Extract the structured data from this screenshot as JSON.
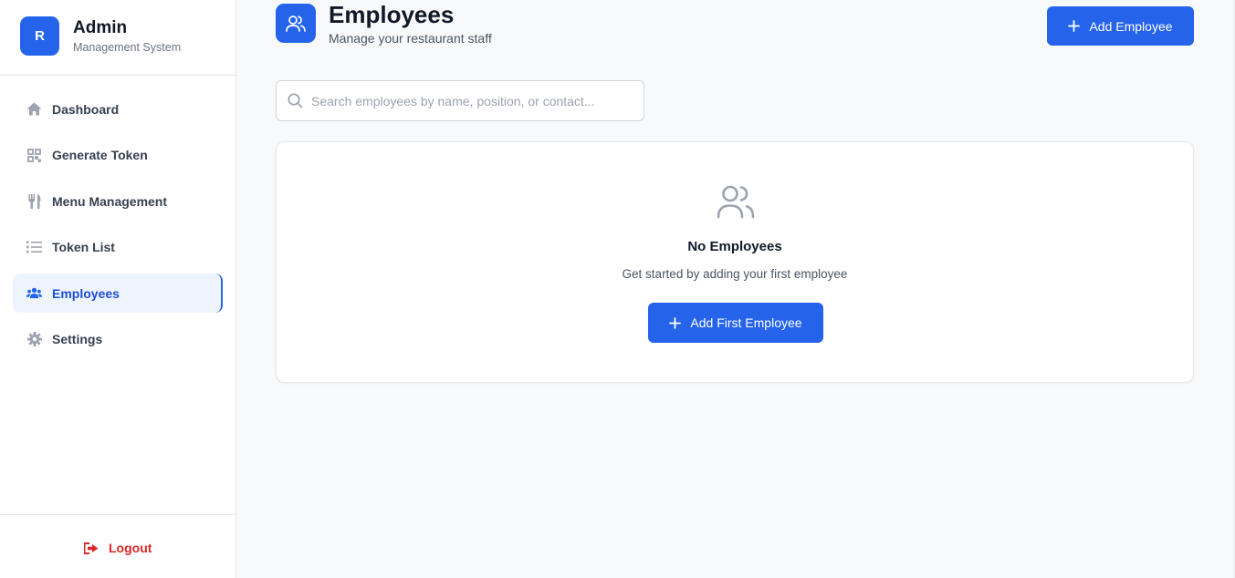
{
  "brand": {
    "logo_letter": "R",
    "title": "Admin",
    "subtitle": "Management System"
  },
  "sidebar": {
    "items": [
      {
        "label": "Dashboard",
        "icon": "home-icon",
        "active": false
      },
      {
        "label": "Generate Token",
        "icon": "qr-grid-icon",
        "active": false
      },
      {
        "label": "Menu Management",
        "icon": "utensils-icon",
        "active": false
      },
      {
        "label": "Token List",
        "icon": "list-icon",
        "active": false
      },
      {
        "label": "Employees",
        "icon": "users-icon",
        "active": true
      },
      {
        "label": "Settings",
        "icon": "gear-icon",
        "active": false
      }
    ],
    "logout_label": "Logout"
  },
  "header": {
    "title": "Employees",
    "subtitle": "Manage your restaurant staff",
    "add_button_label": "Add Employee"
  },
  "search": {
    "placeholder": "Search employees by name, position, or contact...",
    "value": ""
  },
  "empty_state": {
    "title": "No Employees",
    "text": "Get started by adding your first employee",
    "button_label": "Add First Employee"
  },
  "colors": {
    "accent": "#2563eb",
    "active_bg": "#eef4fe",
    "logout": "#dc2626"
  }
}
